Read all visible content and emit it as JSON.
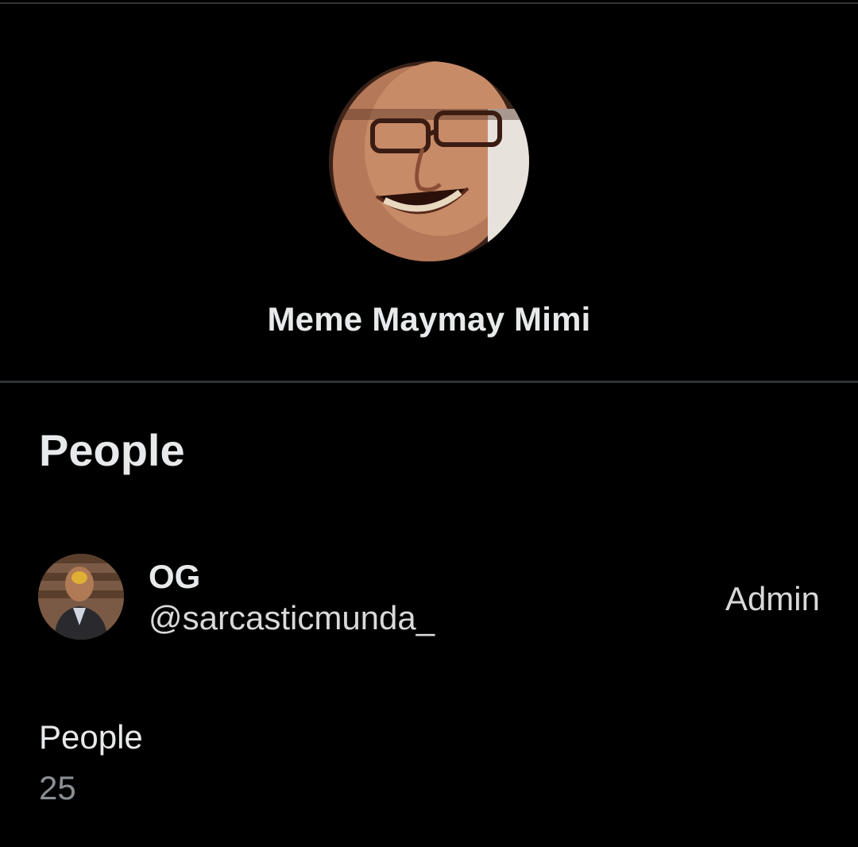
{
  "group": {
    "name": "Meme Maymay Mimi",
    "avatar_icon": "group-avatar-photo"
  },
  "people_section": {
    "heading": "People",
    "members": [
      {
        "name": "OG",
        "handle": "@sarcasticmunda_",
        "role": "Admin",
        "avatar_icon": "user-avatar-photo"
      }
    ]
  },
  "member_count": {
    "label": "People",
    "value": "25"
  },
  "colors": {
    "background": "#000000",
    "divider": "#2f3336",
    "primary_text": "#e7e9ea",
    "secondary_text": "#8b8f94"
  }
}
